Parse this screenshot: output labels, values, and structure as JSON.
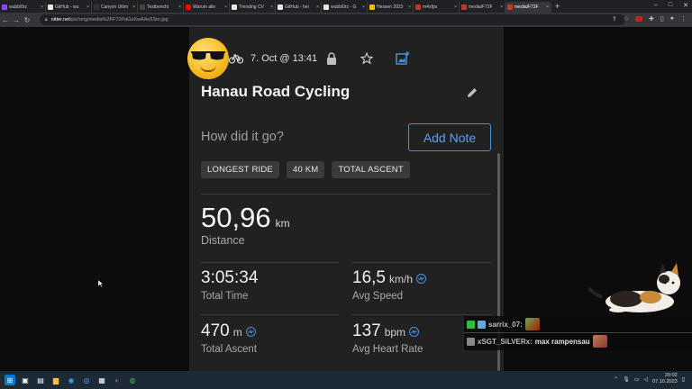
{
  "browser": {
    "tabs": [
      {
        "label": "wubbl0rz",
        "color": "#9146ff"
      },
      {
        "label": "GitHub - wu",
        "color": "#e6e6e6"
      },
      {
        "label": "Canyon Ultim",
        "color": "#333333"
      },
      {
        "label": "Testbericht",
        "color": "#444444"
      },
      {
        "label": "Warum alle",
        "color": "#ff0000"
      },
      {
        "label": "Trending CV",
        "color": "#e6e6e6"
      },
      {
        "label": "GitHub - hei",
        "color": "#e6e6e6"
      },
      {
        "label": "wubbl0rz - G",
        "color": "#e6e6e6"
      },
      {
        "label": "Hessen 2023",
        "color": "#fbbc04"
      },
      {
        "label": "m4xfps",
        "color": "#c0392b"
      },
      {
        "label": "media/F72F",
        "color": "#c0392b"
      },
      {
        "label": "media/F72F",
        "color": "#c0392b"
      }
    ],
    "url_host": "nitter.net",
    "url_path": "/pic/orig/media%2FF72PaGnXwAAo5Sm.jpg"
  },
  "ride": {
    "date_time": "7. Oct @ 13:41",
    "title": "Hanau Road Cycling",
    "note_placeholder": "How did it go?",
    "add_note_label": "Add Note",
    "badges": [
      "LONGEST RIDE",
      "40 KM",
      "TOTAL ASCENT"
    ],
    "distance_value": "50,96",
    "distance_unit": "km",
    "distance_label": "Distance",
    "stats": {
      "total_time_value": "3:05:34",
      "total_time_label": "Total Time",
      "avg_speed_value": "16,5",
      "avg_speed_unit": "km/h",
      "avg_speed_label": "Avg Speed",
      "total_ascent_value": "470",
      "total_ascent_unit": "m",
      "total_ascent_label": "Total Ascent",
      "avg_hr_value": "137",
      "avg_hr_unit": "bpm",
      "avg_hr_label": "Avg Heart Rate"
    }
  },
  "chat": {
    "messages": [
      {
        "user": "sarrix_07:",
        "text": ""
      },
      {
        "user": "xSGT_SiLVERx:",
        "text": "max rampensau"
      }
    ]
  },
  "taskbar": {
    "time": "20:02",
    "date": "07.10.2023"
  },
  "colors": {
    "accent": "#4a90d9",
    "card": "#212121"
  }
}
